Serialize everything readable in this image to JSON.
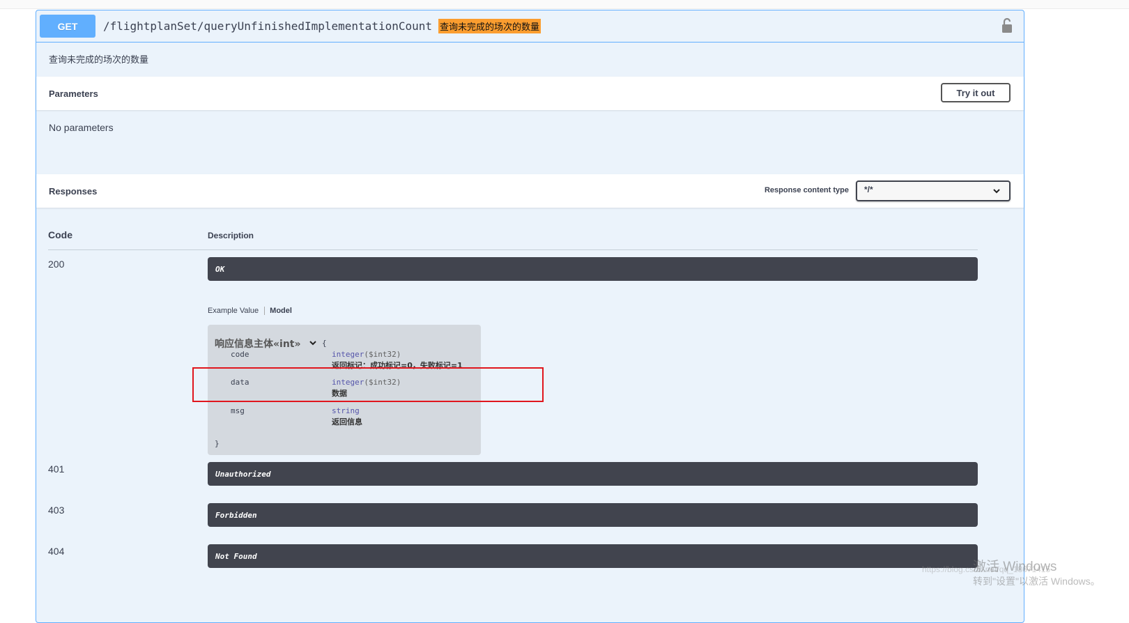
{
  "operation": {
    "method": "GET",
    "path": "/flightplanSet/queryUnfinishedImplementationCount",
    "summary": "查询未完成的场次的数量",
    "description": "查询未完成的场次的数量"
  },
  "parameters": {
    "title": "Parameters",
    "try_button": "Try it out",
    "empty_text": "No parameters"
  },
  "responses": {
    "title": "Responses",
    "content_type_label": "Response content type",
    "content_type_value": "*/*",
    "col_code": "Code",
    "col_description": "Description",
    "items": [
      {
        "code": "200",
        "label": "OK"
      },
      {
        "code": "401",
        "label": "Unauthorized"
      },
      {
        "code": "403",
        "label": "Forbidden"
      },
      {
        "code": "404",
        "label": "Not Found"
      }
    ],
    "tabs": {
      "example": "Example Value",
      "model": "Model"
    },
    "model": {
      "title": "响应信息主体«int»",
      "open_brace": "{",
      "close_brace": "}",
      "properties": [
        {
          "name": "code",
          "type": "integer",
          "format": "($int32)",
          "description": "返回标记：成功标记=0，失败标记=1"
        },
        {
          "name": "data",
          "type": "integer",
          "format": "($int32)",
          "description": "数据"
        },
        {
          "name": "msg",
          "type": "string",
          "format": "",
          "description": "返回信息"
        }
      ]
    }
  },
  "overlay": {
    "watermark_line1": "激活 Windows",
    "watermark_line2": "转到\"设置\"以激活 Windows。",
    "blog_url": "https://blog.csdn.net/qq_18671415"
  },
  "colors": {
    "get": "#61affe",
    "highlight": "#fb9d2f",
    "dark_bar": "#41444e",
    "annotation": "#e0161d"
  }
}
